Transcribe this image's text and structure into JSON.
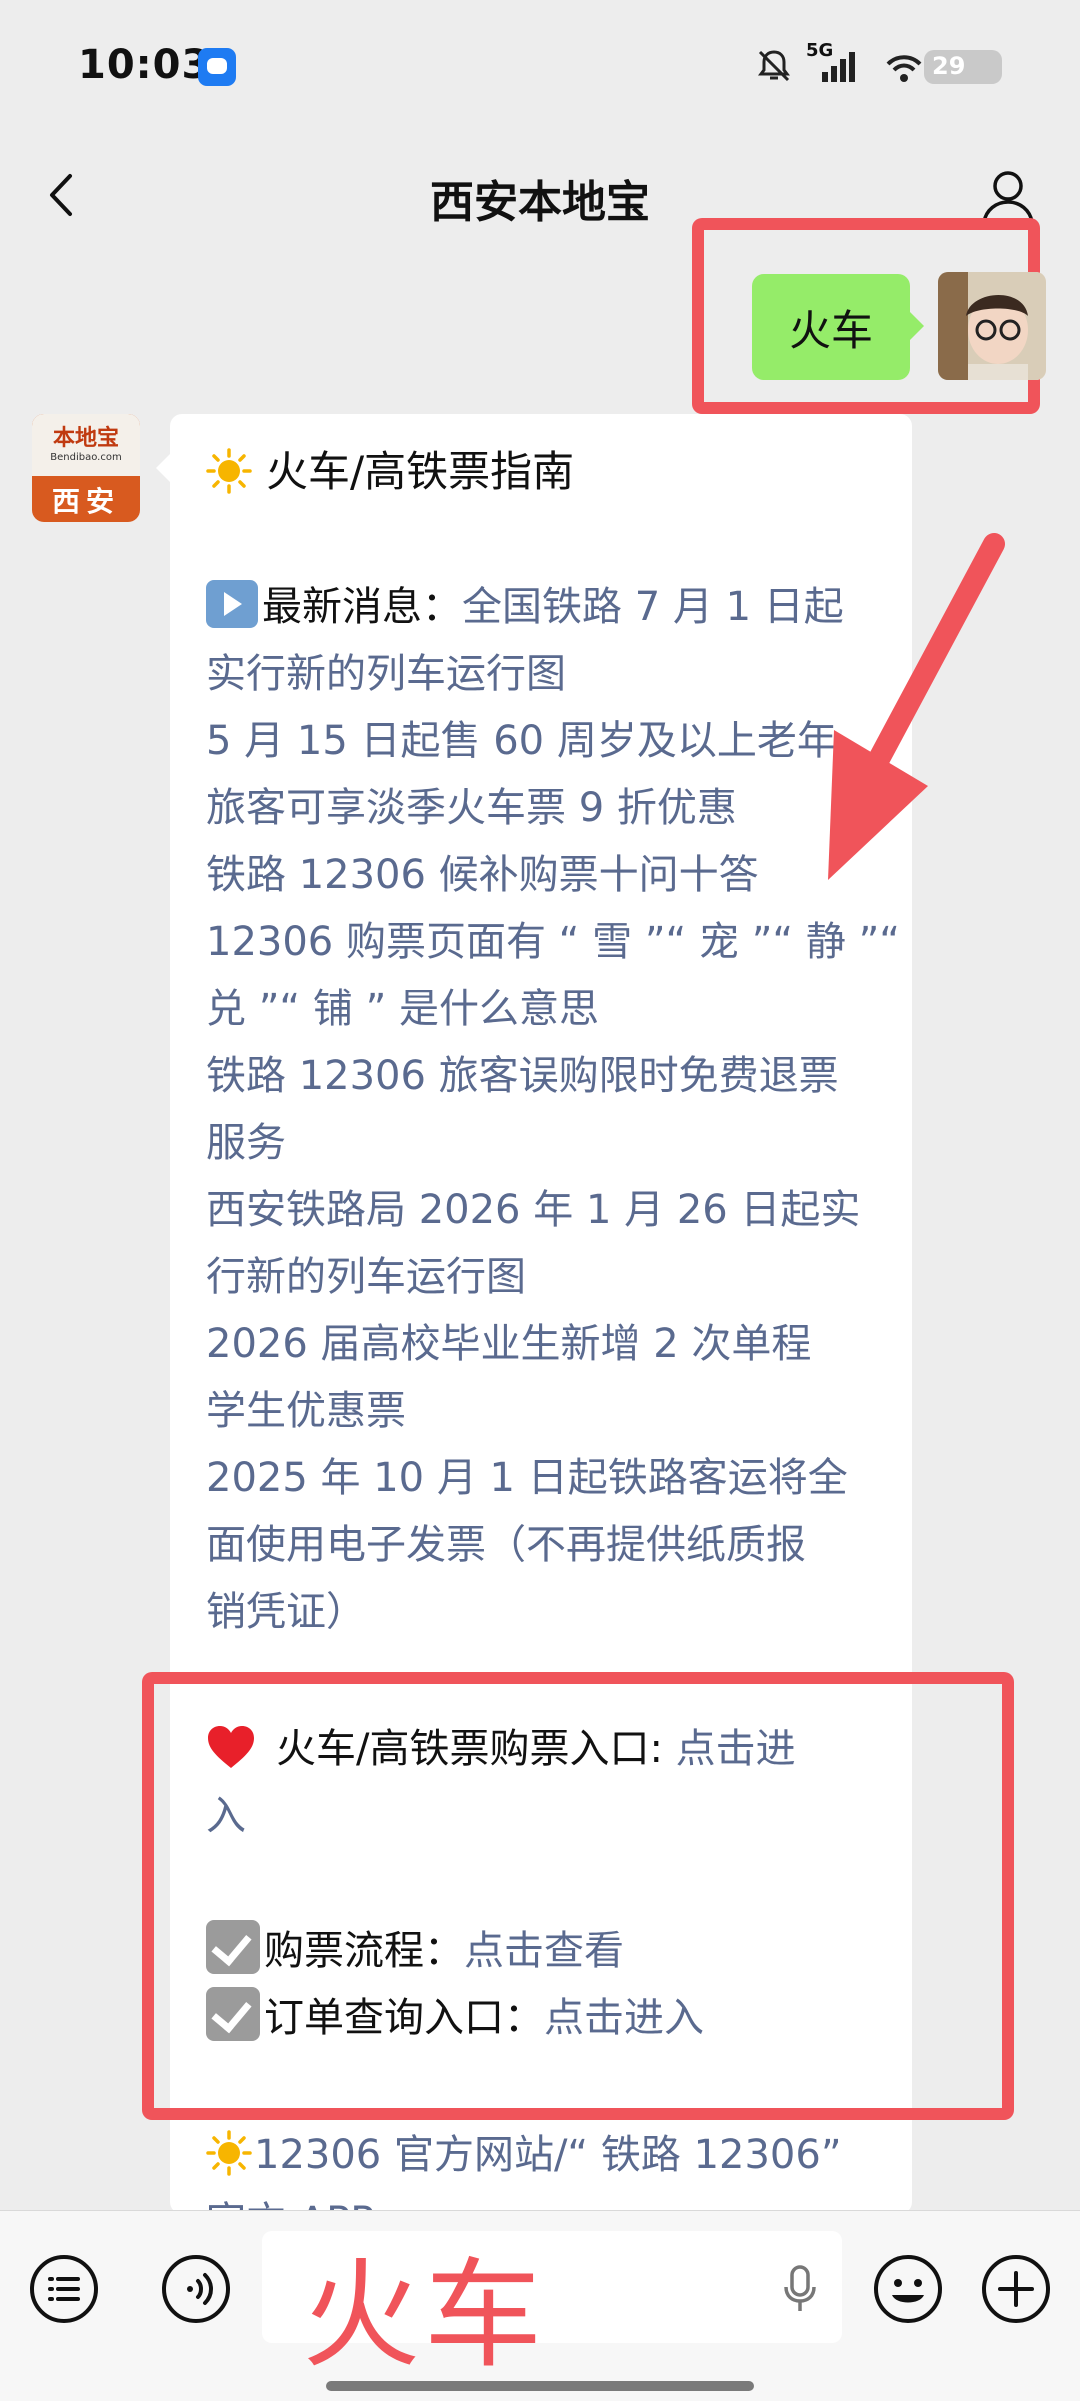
{
  "status_bar": {
    "time": "10:03",
    "network": "5G",
    "battery": "29"
  },
  "header": {
    "title": "西安本地宝"
  },
  "user_message": {
    "text": "火车"
  },
  "bot": {
    "avatar_brand": "本地宝",
    "avatar_domain": "Bendibao.com",
    "avatar_city": "西安"
  },
  "reply": {
    "heading": "火车/高铁票指南",
    "news_label": "最新消息：",
    "news_lines": [
      "全国铁路 7 月 1 日起",
      "实行新的列车运行图",
      "5 月 15 日起售 60 周岁及以上老年",
      "旅客可享淡季火车票 9 折优惠",
      "铁路 12306 候补购票十问十答",
      "12306 购票页面有 “ 雪 ”“ 宠 ”“ 静 ”“",
      "兑 ”“ 铺 ” 是什么意思",
      "铁路 12306 旅客误购限时免费退票",
      "服务",
      "西安铁路局 2026 年 1 月 26 日起实",
      "行新的列车运行图",
      "2026 届高校毕业生新增 2 次单程",
      "学生优惠票",
      "2025 年 10 月 1 日起铁路客运将全",
      "面使用电子发票（不再提供纸质报",
      "销凭证）"
    ],
    "entry_label": "火车/高铁票购票入口: ",
    "entry_link_1": "点击进",
    "entry_link_2": "入",
    "process_label": "购票流程：",
    "process_link": "点击查看",
    "order_label": "订单查询入口：",
    "order_link": "点击进入",
    "official_text": "12306 官方网站/“ 铁路 12306”",
    "official_cut": "官方 APP"
  },
  "input_bar": {
    "value": "火车"
  },
  "colors": {
    "highlight_red": "#f0545a",
    "link_blue": "#5a6a8f",
    "bubble_green": "#95ec69"
  }
}
